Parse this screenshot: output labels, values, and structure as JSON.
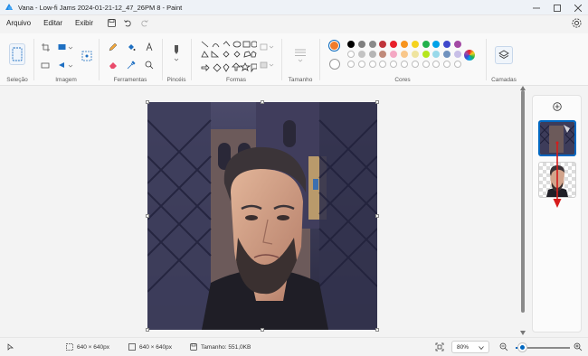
{
  "window": {
    "title": "Vana - Low-fi Jams 2024-01-21-12_47_26PM 8 - Paint",
    "app_icon": "paint-app-icon"
  },
  "menu": {
    "items": [
      "Arquivo",
      "Editar",
      "Exibir"
    ]
  },
  "ribbon": {
    "groups": {
      "selection": "Seleção",
      "image": "Imagem",
      "tools": "Ferramentas",
      "brushes": "Pincéis",
      "shapes": "Formas",
      "size": "Tamanho",
      "colors": "Cores",
      "layers": "Camadas"
    },
    "primary_color": "#f07b2a",
    "secondary_color": "#ffffff",
    "palette_row1": [
      "#000000",
      "#7f7f7f",
      "#8a8a8a",
      "#c0343b",
      "#e8202a",
      "#f7941d",
      "#f5d31f",
      "#22b14c",
      "#00a2e8",
      "#3f48cc",
      "#a349a4"
    ],
    "palette_row2": [
      "#ffffff",
      "#c3c3c3",
      "#b5b5b5",
      "#c08a7a",
      "#f4a8c3",
      "#f9c78a",
      "#efe49f",
      "#b5e61d",
      "#99d9ea",
      "#7092be",
      "#c8bfe7"
    ]
  },
  "canvas": {
    "image_alt": "Illustrated portrait of a bearded man in front of a wrought-iron gate"
  },
  "status": {
    "selection_size": "640 × 640px",
    "canvas_size": "640 × 640px",
    "file_size": "Tamanho: 551,0KB",
    "zoom": "80%",
    "zoom_level": 0.12
  }
}
